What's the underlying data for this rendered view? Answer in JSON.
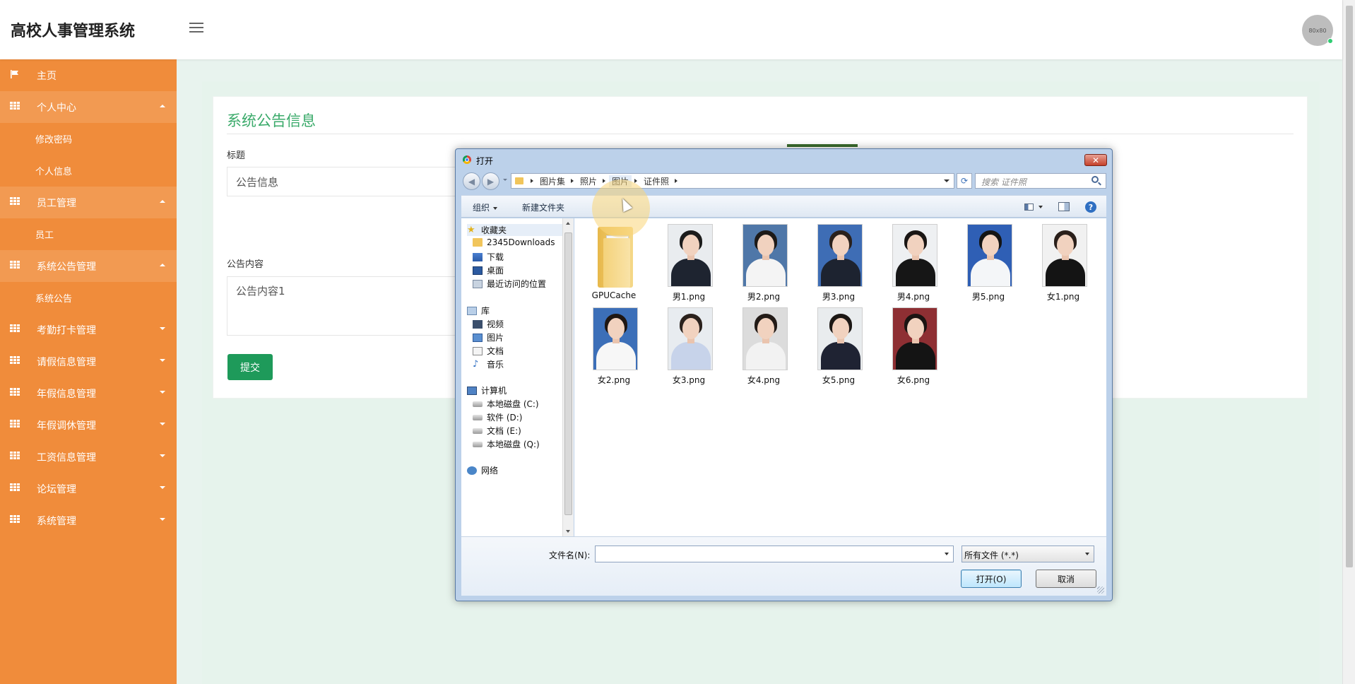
{
  "app": {
    "title": "高校人事管理系统",
    "avatar_text": "80x80"
  },
  "sidebar": {
    "items": [
      {
        "label": "主页",
        "icon": "flag-icon",
        "open": false,
        "sub": []
      },
      {
        "label": "个人中心",
        "icon": "grid-icon",
        "open": true,
        "sub": [
          "修改密码",
          "个人信息"
        ]
      },
      {
        "label": "员工管理",
        "icon": "grid-icon",
        "open": true,
        "sub": [
          "员工"
        ]
      },
      {
        "label": "系统公告管理",
        "icon": "grid-icon",
        "open": true,
        "sub": [
          "系统公告"
        ]
      },
      {
        "label": "考勤打卡管理",
        "icon": "grid-icon",
        "open": false,
        "sub": []
      },
      {
        "label": "请假信息管理",
        "icon": "grid-icon",
        "open": false,
        "sub": []
      },
      {
        "label": "年假信息管理",
        "icon": "grid-icon",
        "open": false,
        "sub": []
      },
      {
        "label": "年假调休管理",
        "icon": "grid-icon",
        "open": false,
        "sub": []
      },
      {
        "label": "工资信息管理",
        "icon": "grid-icon",
        "open": false,
        "sub": []
      },
      {
        "label": "论坛管理",
        "icon": "grid-icon",
        "open": false,
        "sub": []
      },
      {
        "label": "系统管理",
        "icon": "grid-icon",
        "open": false,
        "sub": []
      }
    ]
  },
  "form": {
    "heading": "系统公告信息",
    "title_label": "标题",
    "title_value": "公告信息",
    "content_label": "公告内容",
    "content_value": "公告内容1",
    "submit_label": "提交"
  },
  "dialog": {
    "title": "打开",
    "close_glyph": "✕",
    "breadcrumb": [
      "图片集",
      "照片",
      "图片",
      "证件照"
    ],
    "search_placeholder": "搜索 证件照",
    "toolbar": {
      "organize": "组织",
      "new_folder": "新建文件夹"
    },
    "nav_tree": [
      {
        "label": "收藏夹",
        "icon": "star-icon",
        "group": true
      },
      {
        "label": "2345Downloads",
        "icon": "folder-icon",
        "group": false
      },
      {
        "label": "下载",
        "icon": "download-icon",
        "group": false
      },
      {
        "label": "桌面",
        "icon": "desktop-icon",
        "group": false
      },
      {
        "label": "最近访问的位置",
        "icon": "recent-icon",
        "group": false
      },
      {
        "label": "库",
        "icon": "library-icon",
        "group": true
      },
      {
        "label": "视频",
        "icon": "video-icon",
        "group": false
      },
      {
        "label": "图片",
        "icon": "pictures-icon",
        "group": false
      },
      {
        "label": "文档",
        "icon": "document-icon",
        "group": false
      },
      {
        "label": "音乐",
        "icon": "music-icon",
        "group": false
      },
      {
        "label": "计算机",
        "icon": "computer-icon",
        "group": true
      },
      {
        "label": "本地磁盘 (C:)",
        "icon": "drive-icon",
        "group": false
      },
      {
        "label": "软件 (D:)",
        "icon": "drive-icon",
        "group": false
      },
      {
        "label": "文档 (E:)",
        "icon": "drive-icon",
        "group": false
      },
      {
        "label": "本地磁盘 (Q:)",
        "icon": "drive-icon",
        "group": false
      },
      {
        "label": "网络",
        "icon": "network-icon",
        "group": true
      }
    ],
    "files": [
      {
        "name": "GPUCache",
        "kind": "folder"
      },
      {
        "name": "男1.png",
        "kind": "photo",
        "bg": "#e9ecef",
        "hair": "#1c1c1c",
        "body": "#1e2430"
      },
      {
        "name": "男2.png",
        "kind": "photo",
        "bg": "#4f77a8",
        "hair": "#1d1a18",
        "body": "#f4f4f4"
      },
      {
        "name": "男3.png",
        "kind": "photo",
        "bg": "#3e6db5",
        "hair": "#2a211c",
        "body": "#1d2330"
      },
      {
        "name": "男4.png",
        "kind": "photo",
        "bg": "#eef0f2",
        "hair": "#1a1614",
        "body": "#161616"
      },
      {
        "name": "男5.png",
        "kind": "photo",
        "bg": "#2f5fb5",
        "hair": "#141414",
        "body": "#f4f6f8"
      },
      {
        "name": "女1.png",
        "kind": "photo",
        "bg": "#f1f1f1",
        "hair": "#2a1f1a",
        "body": "#141414"
      },
      {
        "name": "女2.png",
        "kind": "photo",
        "bg": "#3c6fb8",
        "hair": "#1f1713",
        "body": "#f7f7f7"
      },
      {
        "name": "女3.png",
        "kind": "photo",
        "bg": "#e8ecf0",
        "hair": "#2b221d",
        "body": "#c7d3ea"
      },
      {
        "name": "女4.png",
        "kind": "photo",
        "bg": "#dcdcdc",
        "hair": "#231b17",
        "body": "#f2f2f2"
      },
      {
        "name": "女5.png",
        "kind": "photo",
        "bg": "#e9ecee",
        "hair": "#1c1714",
        "body": "#1f2333"
      },
      {
        "name": "女6.png",
        "kind": "photo",
        "bg": "#8e2f33",
        "hair": "#1b1412",
        "body": "#141414"
      }
    ],
    "filename_label": "文件名(N):",
    "filename_value": "",
    "filter_value": "所有文件 (*.*)",
    "open_label": "打开(O)",
    "cancel_label": "取消"
  },
  "colors": {
    "sidebar": "#f08c3b",
    "accent_green": "#3aaa6a",
    "submit": "#1e9a5a"
  }
}
